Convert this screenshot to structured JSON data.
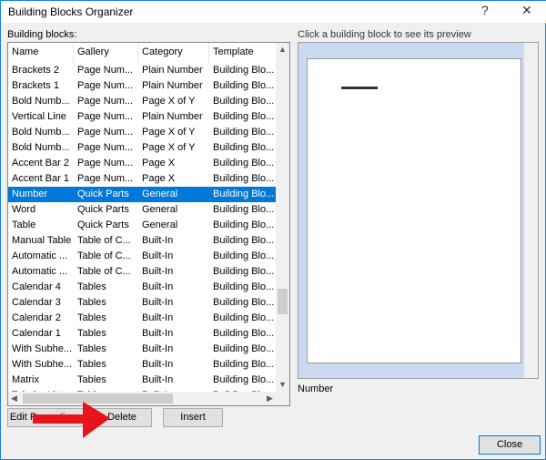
{
  "window": {
    "title": "Building Blocks Organizer",
    "help": "?",
    "close": "✕"
  },
  "building_blocks_label": "Building blocks:",
  "preview_label": "Click a building block to see its preview",
  "preview_name": "Number",
  "columns": [
    "Name",
    "Gallery",
    "Category",
    "Template"
  ],
  "rows": [
    [
      "Brackets 2",
      "Page Num...",
      "Plain Number",
      "Building Blo..."
    ],
    [
      "Brackets 1",
      "Page Num...",
      "Plain Number",
      "Building Blo..."
    ],
    [
      "Bold Numb...",
      "Page Num...",
      "Page X of Y",
      "Building Blo..."
    ],
    [
      "Vertical Line",
      "Page Num...",
      "Plain Number",
      "Building Blo..."
    ],
    [
      "Bold Numb...",
      "Page Num...",
      "Page X of Y",
      "Building Blo..."
    ],
    [
      "Bold Numb...",
      "Page Num...",
      "Page X of Y",
      "Building Blo..."
    ],
    [
      "Accent Bar 2",
      "Page Num...",
      "Page X",
      "Building Blo..."
    ],
    [
      "Accent Bar 1",
      "Page Num...",
      "Page X",
      "Building Blo..."
    ],
    [
      "Number",
      "Quick Parts",
      "General",
      "Building Blo..."
    ],
    [
      "Word",
      "Quick Parts",
      "General",
      "Building Blo..."
    ],
    [
      "Table",
      "Quick Parts",
      "General",
      "Building Blo..."
    ],
    [
      "Manual Table",
      "Table of C...",
      "Built-In",
      "Building Blo..."
    ],
    [
      "Automatic ...",
      "Table of C...",
      "Built-In",
      "Building Blo..."
    ],
    [
      "Automatic ...",
      "Table of C...",
      "Built-In",
      "Building Blo..."
    ],
    [
      "Calendar 4",
      "Tables",
      "Built-In",
      "Building Blo..."
    ],
    [
      "Calendar 3",
      "Tables",
      "Built-In",
      "Building Blo..."
    ],
    [
      "Calendar 2",
      "Tables",
      "Built-In",
      "Building Blo..."
    ],
    [
      "Calendar 1",
      "Tables",
      "Built-In",
      "Building Blo..."
    ],
    [
      "With Subhe...",
      "Tables",
      "Built-In",
      "Building Blo..."
    ],
    [
      "With Subhe...",
      "Tables",
      "Built-In",
      "Building Blo..."
    ],
    [
      "Matrix",
      "Tables",
      "Built-In",
      "Building Blo..."
    ],
    [
      "Tabular List",
      "Tables",
      "Built-In",
      "Building Blo..."
    ]
  ],
  "selected_index": 8,
  "buttons": {
    "edit": "Edit Properties...",
    "delete": "Delete",
    "insert": "Insert",
    "close": "Close"
  }
}
